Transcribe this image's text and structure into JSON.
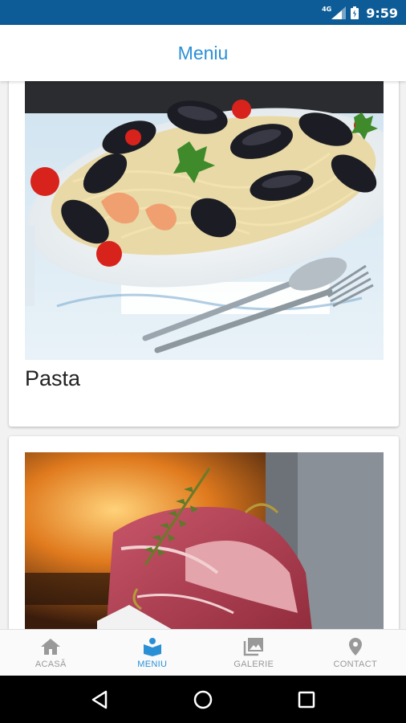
{
  "status_bar": {
    "network": "4G",
    "time": "9:59",
    "background": "#0d5c97"
  },
  "app_bar": {
    "title": "Meniu",
    "title_color": "#2b8fd6"
  },
  "menu_items": [
    {
      "label": "Pasta",
      "image": "seafood-pasta-photo"
    },
    {
      "label": "",
      "image": "raw-meat-photo"
    }
  ],
  "bottom_nav": {
    "accent": "#2b8fd6",
    "items": [
      {
        "label": "ACASĂ",
        "icon": "home-icon",
        "active": false
      },
      {
        "label": "MENIU",
        "icon": "menu-book-icon",
        "active": true
      },
      {
        "label": "GALERIE",
        "icon": "gallery-icon",
        "active": false
      },
      {
        "label": "CONTACT",
        "icon": "location-pin-icon",
        "active": false
      }
    ]
  },
  "system_nav": [
    "back-icon",
    "home-circle-icon",
    "recents-icon"
  ]
}
